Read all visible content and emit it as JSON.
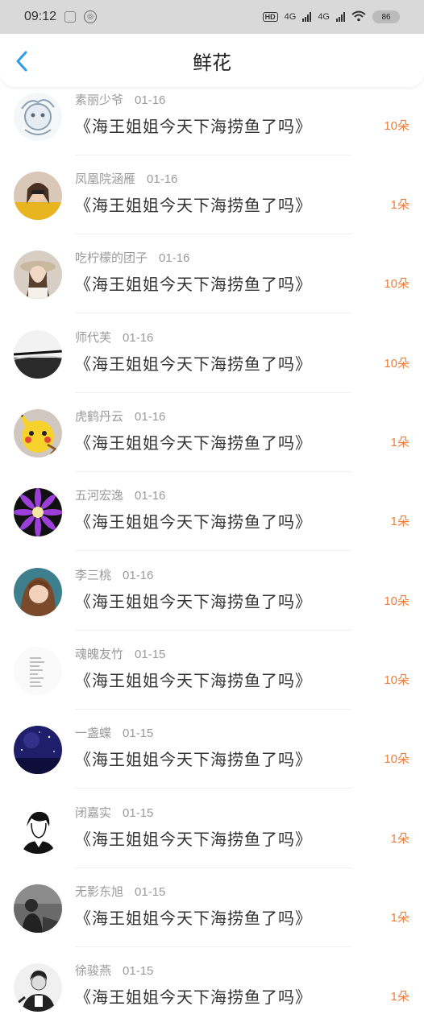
{
  "status_bar": {
    "time": "09:12",
    "network_1": "4G",
    "network_2": "4G",
    "hd": "HD",
    "battery": "86"
  },
  "header": {
    "title": "鲜花"
  },
  "items": [
    {
      "name": "素丽少爷",
      "date": "01-16",
      "message": "《海王姐姐今天下海捞鱼了吗》",
      "count": "10朵",
      "avatar": "cartoon-sketch"
    },
    {
      "name": "凤凰院涵雁",
      "date": "01-16",
      "message": "《海王姐姐今天下海捞鱼了吗》",
      "count": "1朵",
      "avatar": "girl-yellow"
    },
    {
      "name": "吃柠檬的团子",
      "date": "01-16",
      "message": "《海王姐姐今天下海捞鱼了吗》",
      "count": "10朵",
      "avatar": "girl-hat"
    },
    {
      "name": "师代芙",
      "date": "01-16",
      "message": "《海王姐姐今天下海捞鱼了吗》",
      "count": "10朵",
      "avatar": "bridge-bw"
    },
    {
      "name": "虎鹤丹云",
      "date": "01-16",
      "message": "《海王姐姐今天下海捞鱼了吗》",
      "count": "1朵",
      "avatar": "pikachu"
    },
    {
      "name": "五河宏逸",
      "date": "01-16",
      "message": "《海王姐姐今天下海捞鱼了吗》",
      "count": "1朵",
      "avatar": "purple-flower"
    },
    {
      "name": "李三桃",
      "date": "01-16",
      "message": "《海王姐姐今天下海捞鱼了吗》",
      "count": "10朵",
      "avatar": "girl-portrait"
    },
    {
      "name": "魂魄友竹",
      "date": "01-15",
      "message": "《海王姐姐今天下海捞鱼了吗》",
      "count": "10朵",
      "avatar": "text-image"
    },
    {
      "name": "一盏蝶",
      "date": "01-15",
      "message": "《海王姐姐今天下海捞鱼了吗》",
      "count": "10朵",
      "avatar": "night-sky"
    },
    {
      "name": "闭嘉实",
      "date": "01-15",
      "message": "《海王姐姐今天下海捞鱼了吗》",
      "count": "1朵",
      "avatar": "boy-sketch"
    },
    {
      "name": "无影东旭",
      "date": "01-15",
      "message": "《海王姐姐今天下海捞鱼了吗》",
      "count": "1朵",
      "avatar": "dark-figure"
    },
    {
      "name": "徐骏燕",
      "date": "01-15",
      "message": "《海王姐姐今天下海捞鱼了吗》",
      "count": "1朵",
      "avatar": "man-bw"
    }
  ],
  "colors": {
    "accent_blue": "#2e9bf0",
    "count_orange": "#f07d3a",
    "meta_gray": "#9a9a9a",
    "status_bar_bg": "#d9d9d9"
  }
}
